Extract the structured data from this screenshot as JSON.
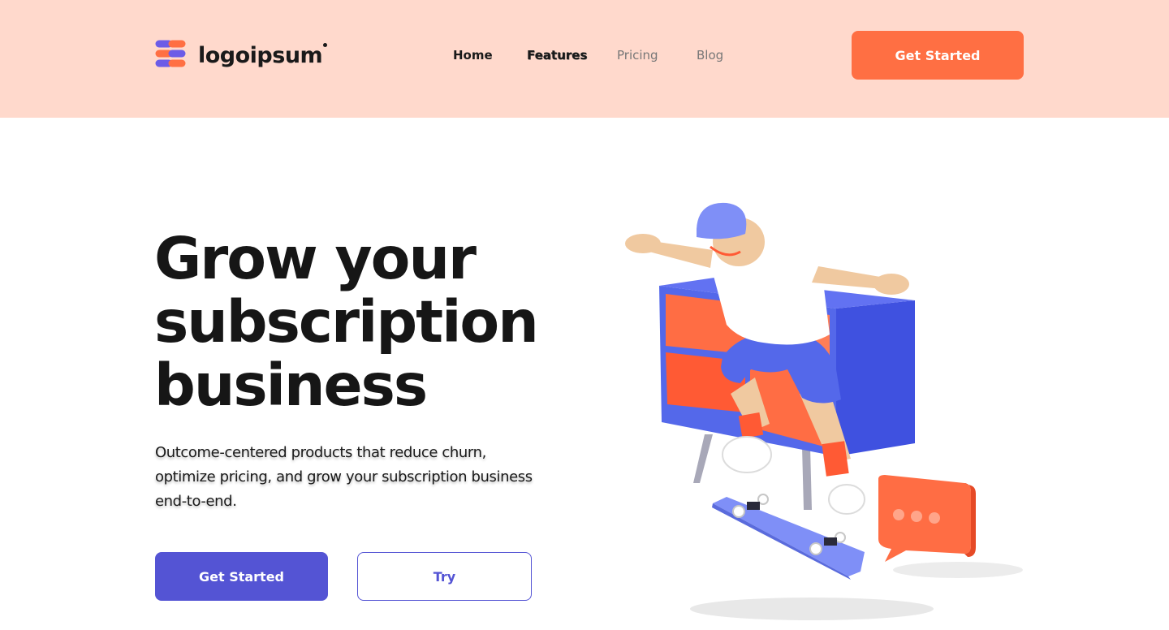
{
  "header": {
    "logo_text": "logoipsum",
    "nav": [
      {
        "label": "Home"
      },
      {
        "label": "Features"
      },
      {
        "label": "Pricing"
      },
      {
        "label": "Blog"
      }
    ],
    "cta_label": "Get Started"
  },
  "hero": {
    "headline_line1": "Grow your",
    "headline_line2": "subscription",
    "headline_line3": "business",
    "subtext": "Outcome-centered products that reduce churn, optimize pricing, and grow your subscription business end-to-end.",
    "primary_label": "Get Started",
    "secondary_label": "Try"
  },
  "illustration": {
    "icon": "skater-with-shelf-illustration"
  },
  "colors": {
    "header_bg": "#ffd9cc",
    "accent_orange": "#ff6f43",
    "accent_purple": "#5454d4",
    "text_dark": "#161616",
    "nav_muted": "#777777"
  }
}
